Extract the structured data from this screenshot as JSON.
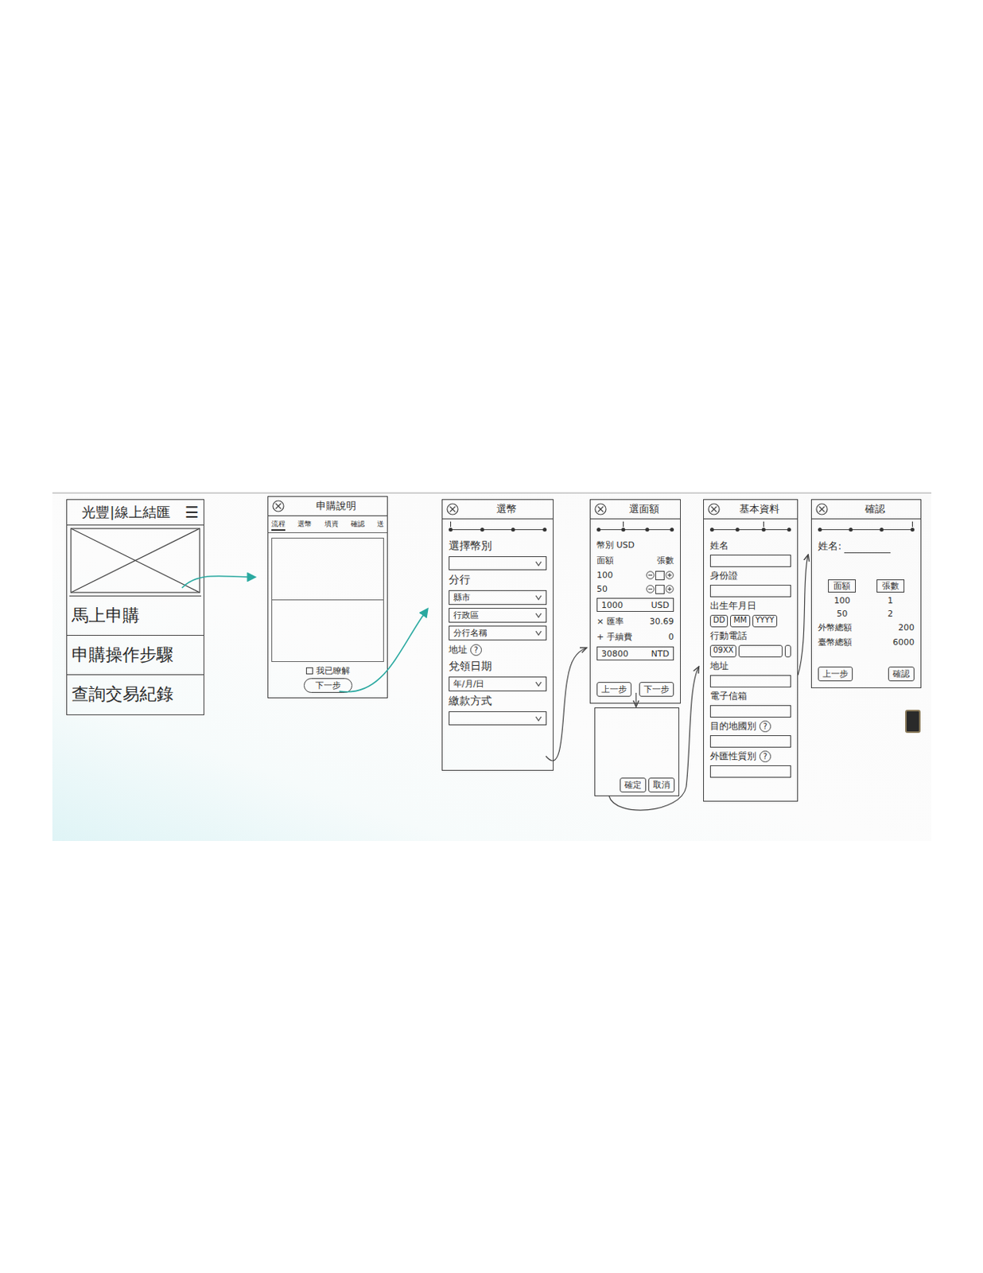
{
  "home": {
    "title": "光豐|線上結匯",
    "menu": "☰",
    "items": [
      "馬上申購",
      "申購操作步驟",
      "查詢交易紀錄"
    ]
  },
  "intro": {
    "title": "申購說明",
    "tabs": [
      {
        "label": "流程",
        "selected": true
      },
      {
        "label": "選幣",
        "selected": false
      },
      {
        "label": "填資",
        "selected": false
      },
      {
        "label": "確認",
        "selected": false
      },
      {
        "label": "送",
        "selected": false
      }
    ],
    "agree": {
      "label": "我已瞭解",
      "checked": false
    },
    "next": "下一步"
  },
  "currency": {
    "title": "選幣",
    "steps": [
      {
        "selected": true
      },
      {
        "selected": false
      },
      {
        "selected": false
      },
      {
        "selected": false
      }
    ],
    "fields": [
      {
        "kind": "label",
        "text": "選擇幣別"
      },
      {
        "kind": "select",
        "text": ""
      },
      {
        "kind": "label",
        "text": "分行"
      },
      {
        "kind": "select",
        "text": "縣市"
      },
      {
        "kind": "select",
        "text": "行政區"
      },
      {
        "kind": "select",
        "text": "分行名稱"
      },
      {
        "kind": "help",
        "text": "地址",
        "help": "?"
      },
      {
        "kind": "label",
        "text": "兌領日期"
      },
      {
        "kind": "select",
        "text": "年/月/日"
      },
      {
        "kind": "label",
        "text": "繳款方式"
      },
      {
        "kind": "select",
        "text": ""
      }
    ]
  },
  "denomination": {
    "title": "選面額",
    "steps": [
      {
        "selected": false
      },
      {
        "selected": true
      },
      {
        "selected": false
      },
      {
        "selected": false
      }
    ],
    "currency": {
      "label": "幣別",
      "value": "USD"
    },
    "columns": [
      "面額",
      "張數"
    ],
    "rows": [
      "100",
      "50"
    ],
    "total": {
      "amount": "1000",
      "unit": "USD"
    },
    "rate": {
      "label": "× 匯率",
      "value": "30.69"
    },
    "fee": {
      "label": "+ 手續費",
      "value": "0"
    },
    "twd": {
      "amount": "30800",
      "unit": "NTD"
    },
    "buttons": [
      "上一步",
      "下一步"
    ]
  },
  "dialog": {
    "buttons": [
      "確定",
      "取消"
    ]
  },
  "profile": {
    "title": "基本資料",
    "steps": [
      {
        "selected": false
      },
      {
        "selected": false
      },
      {
        "selected": true
      },
      {
        "selected": false
      }
    ],
    "fields": [
      {
        "kind": "input",
        "label": "姓名"
      },
      {
        "kind": "input",
        "label": "身份證"
      },
      {
        "kind": "date",
        "label": "出生年月日",
        "parts": [
          "DD",
          "MM",
          "YYYY"
        ]
      },
      {
        "kind": "phone",
        "label": "行動電話",
        "parts": [
          "09XX"
        ]
      },
      {
        "kind": "input",
        "label": "地址"
      },
      {
        "kind": "input",
        "label": "電子信箱"
      },
      {
        "kind": "help",
        "label": "目的地國別",
        "help": "?"
      },
      {
        "kind": "help",
        "label": "外匯性質別",
        "help": "?"
      }
    ]
  },
  "confirm": {
    "title": "確認",
    "steps": [
      {
        "selected": false
      },
      {
        "selected": false
      },
      {
        "selected": false
      },
      {
        "selected": true
      }
    ],
    "name_label": "姓名:",
    "columns": [
      "面額",
      "張數"
    ],
    "rows": [
      [
        "100",
        "1"
      ],
      [
        "50",
        "2"
      ]
    ],
    "totals": [
      {
        "label": "外幣總額",
        "value": "200"
      },
      {
        "label": "臺幣總額",
        "value": "6000"
      }
    ],
    "buttons": [
      "上一步",
      "確認"
    ]
  }
}
